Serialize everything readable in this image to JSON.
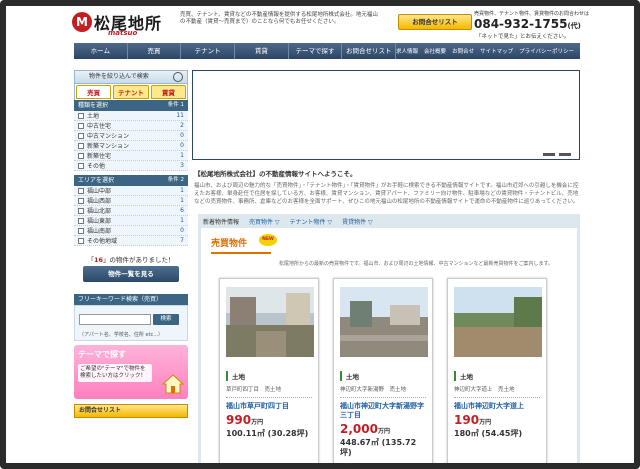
{
  "header": {
    "logo_mark": "M",
    "logo": "松尾地所",
    "logo_sub": "matsuo",
    "tagline": "売買、テナント、賃貸などの不動産情報を提供する松尾地所株式会社。地元福山の不動産（賃貸〜売買まで）のことなら何でもお任せください。",
    "inquiry_button": "お問合せリスト",
    "contact_lead": "売買物件、テナント物件、賃貸物件のお問合わせは",
    "phone": "084-932-1755",
    "phone_suffix": "(代)",
    "phone_note": "「ネットで見た」とお伝えください。"
  },
  "gnav": {
    "items": [
      "ホーム",
      "売買",
      "テナント",
      "賃貸",
      "テーマで探す",
      "お問合せリスト"
    ],
    "sub_items": [
      "求人情報",
      "会社概要",
      "お問合せ",
      "サイトマップ",
      "プライバシーポリシー"
    ]
  },
  "sidebar": {
    "search_title": "物件を絞り込んで検索",
    "tabs": [
      "売買",
      "テナント",
      "賃貸"
    ],
    "type_section": {
      "title": "種類を選択",
      "count": "条件 1",
      "items": [
        {
          "label": "土地",
          "count": "11"
        },
        {
          "label": "中古住宅",
          "count": "2"
        },
        {
          "label": "中古マンション",
          "count": "0"
        },
        {
          "label": "新築マンション",
          "count": "0"
        },
        {
          "label": "新築住宅",
          "count": "1"
        },
        {
          "label": "その他",
          "count": "3"
        }
      ]
    },
    "area_section": {
      "title": "エリアを選択",
      "count": "条件 2",
      "items": [
        {
          "label": "福山中部",
          "count": "1"
        },
        {
          "label": "福山西部",
          "count": "1"
        },
        {
          "label": "福山北部",
          "count": "6"
        },
        {
          "label": "福山東部",
          "count": "1"
        },
        {
          "label": "福山南部",
          "count": "0"
        },
        {
          "label": "その他地域",
          "count": "7"
        }
      ]
    },
    "hits_prefix": "「",
    "hits_count": "16",
    "hits_suffix": "」の物件がありました！",
    "list_button": "物件一覧を見る",
    "keyword": {
      "title": "フリーキーワード検索（売買）",
      "button": "検索",
      "hint": "（アパート名、学校名、住所 etc...）"
    },
    "theme_banner": {
      "title": "テーマで探す",
      "text": "ご希望の\"テーマ\"で物件を検索したい方はクリック！"
    },
    "contact_list": "お問合せリスト"
  },
  "intro": {
    "title": "【松尾地所株式会社】の不動産情報サイトへようこそ。",
    "body": "福山市、および周辺の魅力的な「売買物件」・「テナント物件」・「賃貸物件」がお手軽に検索できる不動産情報サイトです。福山市近郊への引越しを機会に控えたお客様、単身赴任で住居を探している方、お客様、賃貸マンション、賃貸アパート、ファミリー向け物件、駐車場などの賃貸物件・テナントビル、売地などの売買物件、事務所、倉庫などのお客様を全面サポート、ぜひこの地元福山の松尾地所の不動産情報サイトで運命の不動産物件に巡りあってください。"
  },
  "new_listings": {
    "tabs_title": "新着物件情報",
    "tabs": [
      "売買物件 ▽",
      "テナント物件 ▽",
      "賃貸物件 ▽"
    ],
    "heading": "売買物件",
    "badge": "NEW",
    "note": "松尾地所からの最新の売買物件です。福山市、および周辺の土地情報、中古マンションなど最新売買物件をご案内します。",
    "cards": [
      {
        "type": "土地",
        "addr": "草戸町四丁目　売土地",
        "loc": "福山市草戸町四丁目",
        "price": "990",
        "unit": "万円",
        "area": "100.11㎡ (30.28坪)"
      },
      {
        "type": "土地",
        "addr": "神辺町大字新湯野　売土地",
        "loc": "福山市神辺町大字新湯野字三丁目",
        "price": "2,000",
        "unit": "万円",
        "area": "448.67㎡ (135.72坪)"
      },
      {
        "type": "土地",
        "addr": "神辺町大字道上　売土地",
        "loc": "福山市神辺町大字道上",
        "price": "190",
        "unit": "万円",
        "area": "180㎡ (54.45坪)"
      }
    ]
  }
}
